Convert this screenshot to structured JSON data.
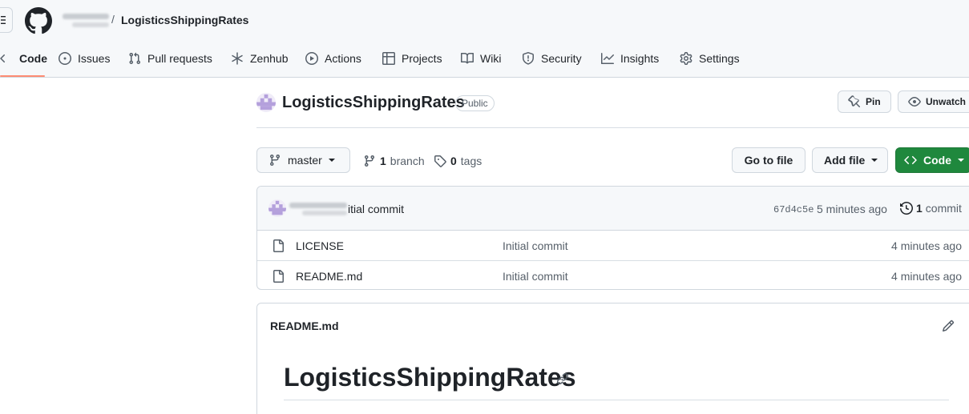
{
  "header": {
    "breadcrumb_separator": "/",
    "repo_name": "LogisticsShippingRates",
    "icons": {
      "menu": "hamburger-icon",
      "logo": "github-mark-icon"
    }
  },
  "nav": {
    "tabs": [
      {
        "label": "Code",
        "icon": "code-icon",
        "selected": true
      },
      {
        "label": "Issues",
        "icon": "issue-opened-icon"
      },
      {
        "label": "Pull requests",
        "icon": "git-pull-request-icon"
      },
      {
        "label": "Zenhub",
        "icon": "zenhub-icon"
      },
      {
        "label": "Actions",
        "icon": "play-icon"
      },
      {
        "label": "Projects",
        "icon": "table-icon"
      },
      {
        "label": "Wiki",
        "icon": "book-icon"
      },
      {
        "label": "Security",
        "icon": "shield-icon"
      },
      {
        "label": "Insights",
        "icon": "graph-icon"
      },
      {
        "label": "Settings",
        "icon": "gear-icon"
      }
    ],
    "selected_color": "#fd8c73"
  },
  "repo": {
    "title": "LogisticsShippingRates",
    "visibility": "Public",
    "pin_label": "Pin",
    "watch_label": "Unwatch"
  },
  "file_nav": {
    "branch_button": "master",
    "branch_count": "1",
    "branch_label": "branch",
    "tag_count": "0",
    "tag_label": "tags",
    "go_to_file": "Go to file",
    "add_file": "Add file",
    "code_button": "Code",
    "code_button_color": "#1f883d"
  },
  "latest_commit": {
    "message": "itial commit",
    "sha": "67d4c5e",
    "time": "5 minutes ago",
    "count": "1",
    "count_label": "commit"
  },
  "files": [
    {
      "name": "LICENSE",
      "commit": "Initial commit",
      "time": "4 minutes ago",
      "icon": "file-icon"
    },
    {
      "name": "README.md",
      "commit": "Initial commit",
      "time": "4 minutes ago",
      "icon": "file-icon"
    }
  ],
  "readme": {
    "filename": "README.md",
    "heading": "LogisticsShippingRates",
    "edit_icon": "pencil-icon",
    "anchor_icon": "link-icon"
  }
}
